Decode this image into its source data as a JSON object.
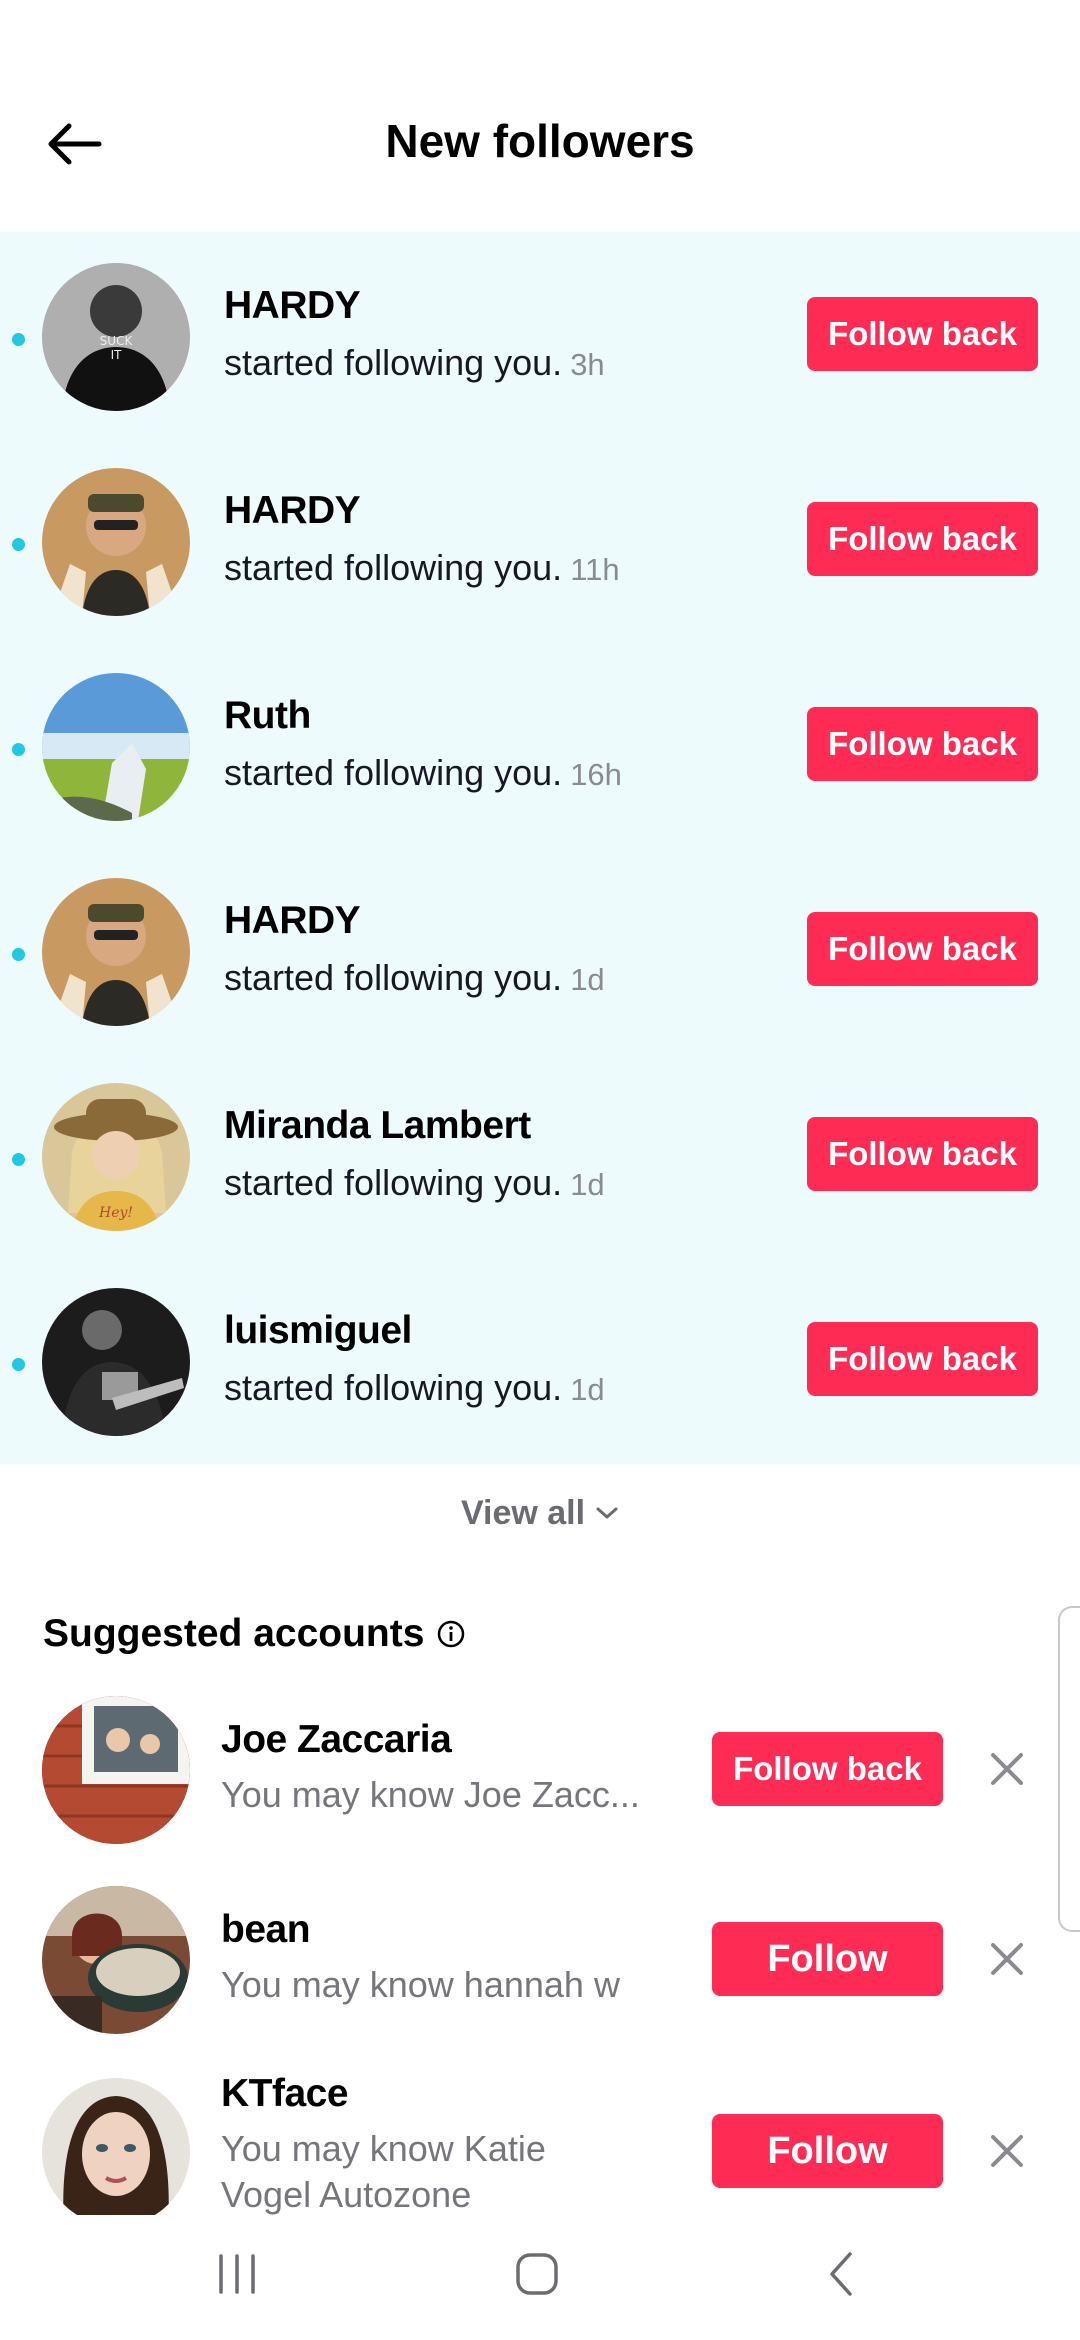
{
  "header": {
    "title": "New followers",
    "back_icon": "arrow-left-icon"
  },
  "followers": [
    {
      "name": "HARDY",
      "action": "started following you.",
      "time": "3h",
      "button": "Follow back"
    },
    {
      "name": "HARDY",
      "action": "started following you.",
      "time": "11h",
      "button": "Follow back"
    },
    {
      "name": "Ruth",
      "action": "started following you.",
      "time": "16h",
      "button": "Follow back"
    },
    {
      "name": "HARDY",
      "action": "started following you.",
      "time": "1d",
      "button": "Follow back"
    },
    {
      "name": "Miranda Lambert",
      "action": "started following you.",
      "time": "1d",
      "button": "Follow back"
    },
    {
      "name": "luismiguel",
      "action": "started following you.",
      "time": "1d",
      "button": "Follow back"
    }
  ],
  "view_all": {
    "label": "View all",
    "icon": "chevron-down-icon"
  },
  "suggested": {
    "title": "Suggested accounts",
    "info_icon": "info-icon",
    "items": [
      {
        "name": "Joe Zaccaria",
        "subtitle": "You may know Joe Zacc...",
        "button": "Follow back"
      },
      {
        "name": "bean",
        "subtitle": "You may know hannah w",
        "button": "Follow"
      },
      {
        "name": "KTface",
        "subtitle": "You may know Katie Vogel Autozone",
        "button": "Follow"
      }
    ]
  },
  "navbar": {
    "recents_icon": "recent-apps-icon",
    "home_icon": "home-icon",
    "back_icon": "back-icon"
  },
  "colors": {
    "accent": "#fe2c55",
    "unread_bg": "#eefbfd",
    "unread_dot": "#20c8e2"
  }
}
